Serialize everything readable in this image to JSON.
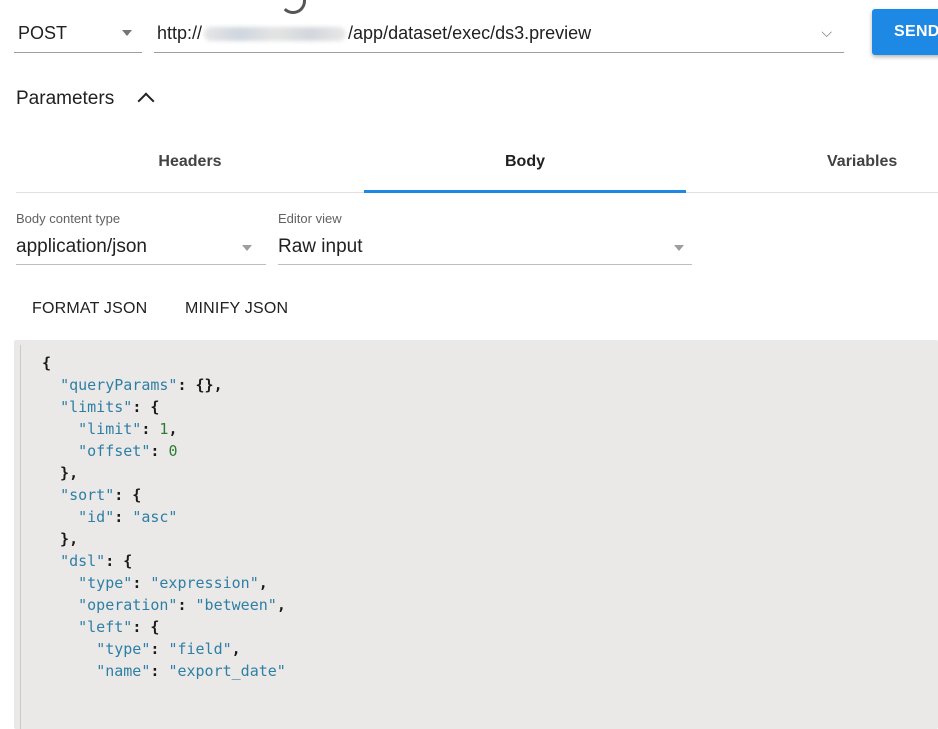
{
  "request": {
    "method": "POST",
    "url_prefix": "http://",
    "url_suffix": "/app/dataset/exec/ds3.preview",
    "url_chevron": "⌵",
    "send_label": "SEND"
  },
  "parameters": {
    "title": "Parameters"
  },
  "tabs": [
    {
      "label": "Headers"
    },
    {
      "label": "Body"
    },
    {
      "label": "Variables"
    }
  ],
  "body_settings": {
    "content_type_caption": "Body content type",
    "content_type_value": "application/json",
    "editor_view_caption": "Editor view",
    "editor_view_value": "Raw input"
  },
  "actions": {
    "format_label": "FORMAT JSON",
    "minify_label": "MINIFY JSON"
  },
  "editor": {
    "lines": [
      [
        [
          "p",
          "{"
        ]
      ],
      [
        [
          "p",
          "  "
        ],
        [
          "k",
          "\"queryParams\""
        ],
        [
          "p",
          ": {},"
        ]
      ],
      [
        [
          "p",
          "  "
        ],
        [
          "k",
          "\"limits\""
        ],
        [
          "p",
          ": {"
        ]
      ],
      [
        [
          "p",
          "    "
        ],
        [
          "k",
          "\"limit\""
        ],
        [
          "p",
          ": "
        ],
        [
          "n",
          "1"
        ],
        [
          "p",
          ","
        ]
      ],
      [
        [
          "p",
          "    "
        ],
        [
          "k",
          "\"offset\""
        ],
        [
          "p",
          ": "
        ],
        [
          "n",
          "0"
        ]
      ],
      [
        [
          "p",
          "  },"
        ]
      ],
      [
        [
          "p",
          "  "
        ],
        [
          "k",
          "\"sort\""
        ],
        [
          "p",
          ": {"
        ]
      ],
      [
        [
          "p",
          "    "
        ],
        [
          "k",
          "\"id\""
        ],
        [
          "p",
          ": "
        ],
        [
          "s",
          "\"asc\""
        ]
      ],
      [
        [
          "p",
          "  },"
        ]
      ],
      [
        [
          "p",
          "  "
        ],
        [
          "k",
          "\"dsl\""
        ],
        [
          "p",
          ": {"
        ]
      ],
      [
        [
          "p",
          "    "
        ],
        [
          "k",
          "\"type\""
        ],
        [
          "p",
          ": "
        ],
        [
          "s",
          "\"expression\""
        ],
        [
          "p",
          ","
        ]
      ],
      [
        [
          "p",
          "    "
        ],
        [
          "k",
          "\"operation\""
        ],
        [
          "p",
          ": "
        ],
        [
          "s",
          "\"between\""
        ],
        [
          "p",
          ","
        ]
      ],
      [
        [
          "p",
          "    "
        ],
        [
          "k",
          "\"left\""
        ],
        [
          "p",
          ": {"
        ]
      ],
      [
        [
          "p",
          "      "
        ],
        [
          "k",
          "\"type\""
        ],
        [
          "p",
          ": "
        ],
        [
          "s",
          "\"field\""
        ],
        [
          "p",
          ","
        ]
      ],
      [
        [
          "p",
          "      "
        ],
        [
          "k",
          "\"name\""
        ],
        [
          "p",
          ": "
        ],
        [
          "s",
          "\"export_date\""
        ]
      ]
    ]
  }
}
